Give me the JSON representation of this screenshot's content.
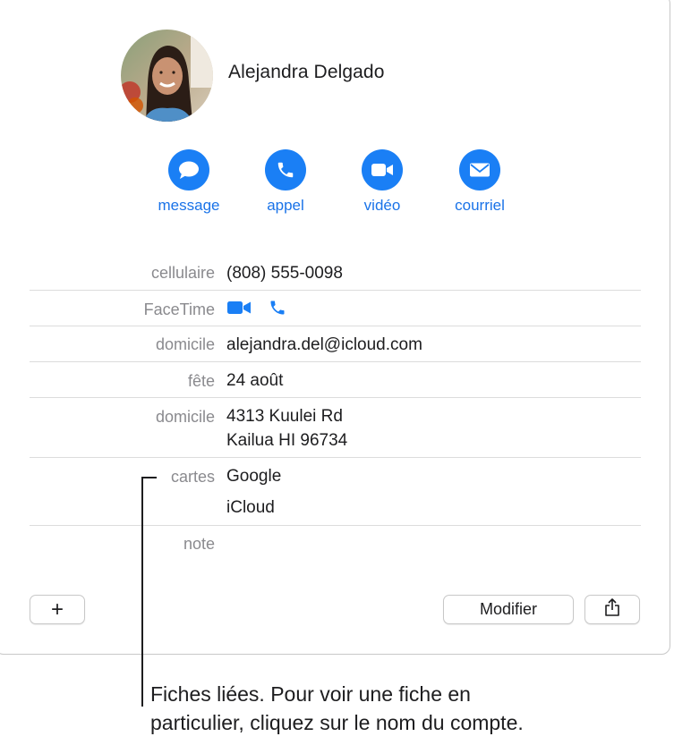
{
  "contact": {
    "name": "Alejandra Delgado"
  },
  "actions": [
    {
      "label": "message",
      "icon": "message-bubble-icon"
    },
    {
      "label": "appel",
      "icon": "phone-icon"
    },
    {
      "label": "vidéo",
      "icon": "video-camera-icon"
    },
    {
      "label": "courriel",
      "icon": "envelope-icon"
    }
  ],
  "fields": {
    "mobile": {
      "label": "cellulaire",
      "value": "(808) 555-0098"
    },
    "facetime": {
      "label": "FaceTime"
    },
    "email": {
      "label": "domicile",
      "value": "alejandra.del@icloud.com"
    },
    "birthday": {
      "label": "fête",
      "value": "24 août"
    },
    "address": {
      "label": "domicile",
      "line1": "4313 Kuulei Rd",
      "line2": "Kailua HI 96734"
    },
    "cards": {
      "label": "cartes",
      "accounts": [
        "Google",
        "iCloud"
      ]
    },
    "note": {
      "label": "note"
    }
  },
  "buttons": {
    "add": "+",
    "edit": "Modifier"
  },
  "callout": {
    "line1": "Fiches liées. Pour voir une fiche en",
    "line2": "particulier, cliquez sur le nom du compte."
  },
  "colors": {
    "accent": "#1a7ff5",
    "label_gray": "#8a8a8e"
  }
}
